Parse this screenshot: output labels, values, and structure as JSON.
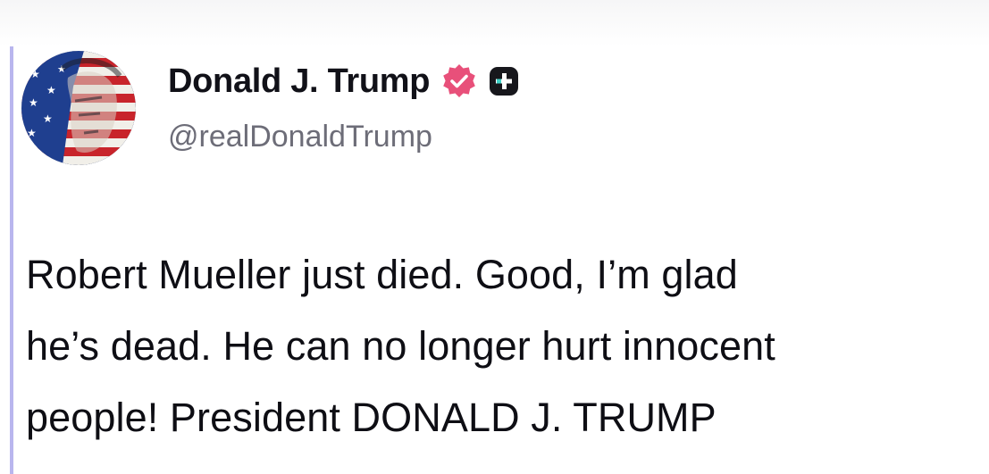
{
  "post": {
    "author": {
      "display_name": "Donald J. Trump",
      "handle": "@realDonaldTrump",
      "verified_badge_icon": "verified-check-icon",
      "verified_badge_color": "#e8507a",
      "plus_badge_icon": "plus-badge-icon",
      "avatar": "flag-portrait-avatar"
    },
    "body_lines": [
      "Robert Mueller just died. Good, I’m glad",
      "he’s dead. He can no longer hurt innocent",
      "people! President DONALD J. TRUMP"
    ]
  },
  "colors": {
    "accent_bar": "#b9b6ee",
    "text": "#0e0e14",
    "handle_text": "#6d6d78"
  }
}
